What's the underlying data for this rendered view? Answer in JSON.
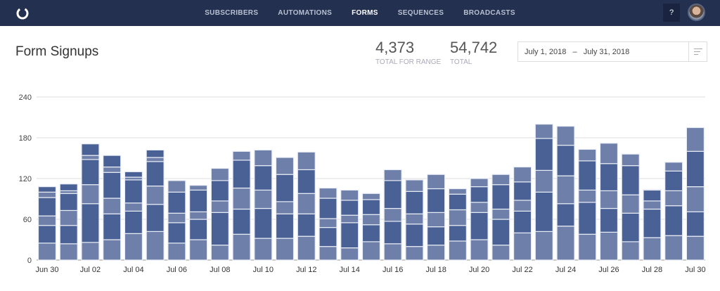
{
  "nav": {
    "items": [
      {
        "label": "SUBSCRIBERS"
      },
      {
        "label": "AUTOMATIONS"
      },
      {
        "label": "FORMS",
        "active": true
      },
      {
        "label": "SEQUENCES"
      },
      {
        "label": "BROADCASTS"
      }
    ],
    "help_label": "?"
  },
  "page": {
    "title": "Form Signups"
  },
  "stats": {
    "range_total": "4,373",
    "range_label": "TOTAL FOR RANGE",
    "total": "54,742",
    "total_label": "TOTAL"
  },
  "date_range": {
    "text": "July 1, 2018   –   July 31, 2018"
  },
  "colors": {
    "header": "#233050",
    "light": "#6e80aa",
    "dark": "#4a6196"
  },
  "chart_data": {
    "type": "bar",
    "stacked": true,
    "ylim": [
      0,
      240
    ],
    "yticks": [
      0,
      60,
      120,
      180,
      240
    ],
    "grid": true,
    "categories": [
      "Jun 30",
      "Jul 01",
      "Jul 02",
      "Jul 03",
      "Jul 04",
      "Jul 05",
      "Jul 06",
      "Jul 07",
      "Jul 08",
      "Jul 09",
      "Jul 10",
      "Jul 11",
      "Jul 12",
      "Jul 13",
      "Jul 14",
      "Jul 15",
      "Jul 16",
      "Jul 17",
      "Jul 18",
      "Jul 19",
      "Jul 20",
      "Jul 21",
      "Jul 22",
      "Jul 23",
      "Jul 24",
      "Jul 25",
      "Jul 26",
      "Jul 27",
      "Jul 28",
      "Jul 29",
      "Jul 30"
    ],
    "xtick_labels": [
      "Jun 30",
      "Jul 02",
      "Jul 04",
      "Jul 06",
      "Jul 08",
      "Jul 10",
      "Jul 12",
      "Jul 14",
      "Jul 16",
      "Jul 18",
      "Jul 20",
      "Jul 22",
      "Jul 24",
      "Jul 26",
      "Jul 28",
      "Jul 30"
    ],
    "stacks": [
      [
        25,
        26,
        14,
        27,
        8,
        8
      ],
      [
        24,
        27,
        22,
        25,
        4,
        10
      ],
      [
        26,
        57,
        28,
        37,
        6,
        17
      ],
      [
        30,
        38,
        23,
        38,
        8,
        17
      ],
      [
        39,
        33,
        12,
        34,
        4,
        8
      ],
      [
        42,
        40,
        27,
        36,
        6,
        11
      ],
      [
        25,
        30,
        14,
        31,
        17
      ],
      [
        30,
        30,
        11,
        32,
        7
      ],
      [
        22,
        48,
        17,
        30,
        18
      ],
      [
        38,
        37,
        31,
        41,
        13
      ],
      [
        32,
        44,
        27,
        36,
        23
      ],
      [
        32,
        36,
        18,
        40,
        25
      ],
      [
        35,
        33,
        30,
        35,
        26
      ],
      [
        20,
        28,
        13,
        30,
        15
      ],
      [
        18,
        37,
        11,
        22,
        15
      ],
      [
        27,
        25,
        15,
        22,
        9
      ],
      [
        24,
        33,
        19,
        41,
        16
      ],
      [
        20,
        33,
        15,
        33,
        17
      ],
      [
        22,
        27,
        21,
        35,
        21
      ],
      [
        28,
        23,
        23,
        23,
        8
      ],
      [
        30,
        40,
        15,
        23,
        12
      ],
      [
        22,
        38,
        15,
        36,
        15
      ],
      [
        40,
        32,
        16,
        27,
        22
      ],
      [
        42,
        58,
        32,
        47,
        21
      ],
      [
        50,
        33,
        41,
        45,
        28
      ],
      [
        38,
        47,
        18,
        43,
        17
      ],
      [
        41,
        35,
        26,
        40,
        30
      ],
      [
        27,
        42,
        27,
        43,
        17
      ],
      [
        33,
        42,
        12,
        16,
        1
      ],
      [
        36,
        44,
        22,
        29,
        13
      ],
      [
        35,
        36,
        37,
        52,
        35
      ]
    ]
  }
}
